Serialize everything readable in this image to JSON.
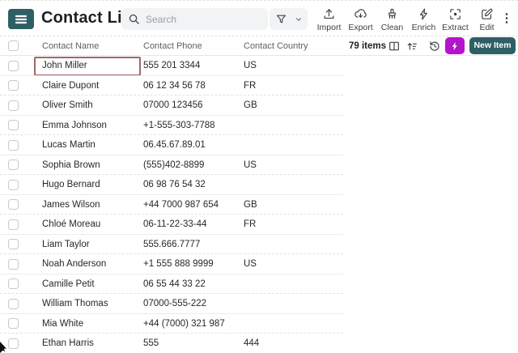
{
  "app": {
    "title": "Contact List",
    "search_placeholder": "Search",
    "toolbar_actions": [
      {
        "id": "import",
        "label": "Import"
      },
      {
        "id": "export",
        "label": "Export"
      },
      {
        "id": "clean",
        "label": "Clean"
      },
      {
        "id": "enrich",
        "label": "Enrich"
      },
      {
        "id": "extract",
        "label": "Extract"
      },
      {
        "id": "edit",
        "label": "Edit"
      }
    ],
    "kebab_glyph": "⋮",
    "items_count": "79 items",
    "new_item_label": "New Item"
  },
  "colors": {
    "teal": "#2e5f67",
    "magenta": "#b414cb",
    "selection": "#9c6a68"
  },
  "table": {
    "columns": [
      "Contact Name",
      "Contact Phone",
      "Contact Country"
    ],
    "rows": [
      {
        "name": "John Miller",
        "phone": "555 201 3344",
        "country": "US",
        "selected": true
      },
      {
        "name": "Claire Dupont",
        "phone": "06 12 34 56 78",
        "country": "FR"
      },
      {
        "name": "Oliver Smith",
        "phone": "07000 123456",
        "country": "GB"
      },
      {
        "name": "Emma Johnson",
        "phone": "+1-555-303-7788",
        "country": ""
      },
      {
        "name": "Lucas Martin",
        "phone": "06.45.67.89.01",
        "country": ""
      },
      {
        "name": "Sophia Brown",
        "phone": "(555)402-8899",
        "country": "US"
      },
      {
        "name": "Hugo Bernard",
        "phone": "06 98 76 54 32",
        "country": ""
      },
      {
        "name": "James Wilson",
        "phone": "+44 7000 987 654",
        "country": "GB"
      },
      {
        "name": "Chloé Moreau",
        "phone": "06-11-22-33-44",
        "country": "FR"
      },
      {
        "name": "Liam Taylor",
        "phone": "555.666.7777",
        "country": ""
      },
      {
        "name": "Noah Anderson",
        "phone": "+1 555 888 9999",
        "country": "US"
      },
      {
        "name": "Camille Petit",
        "phone": "06 55 44 33 22",
        "country": ""
      },
      {
        "name": "William Thomas",
        "phone": "07000-555-222",
        "country": ""
      },
      {
        "name": "Mia White",
        "phone": "+44 (7000) 321 987",
        "country": ""
      },
      {
        "name": "Ethan Harris",
        "phone": "555",
        "country": "444"
      }
    ]
  }
}
